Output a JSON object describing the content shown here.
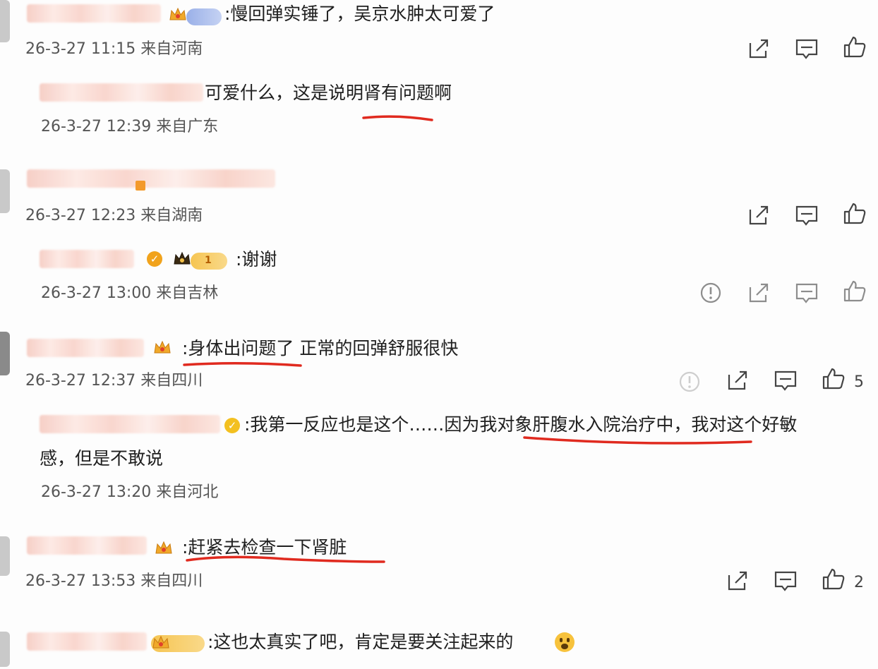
{
  "comments": [
    {
      "text": ":慢回弹实锤了，吴京水肿太可爱了",
      "meta": "26-3-27 11:15 来自河南",
      "reply": {
        "text": "可爱什么，这是说明肾有问题啊",
        "meta": "26-3-27 12:39 来自广东"
      }
    },
    {
      "meta": "26-3-27 12:23 来自湖南",
      "reply": {
        "text": ":谢谢",
        "meta": "26-3-27 13:00 来自吉林",
        "level": "1"
      }
    },
    {
      "text": ":身体出问题了 正常的回弹舒服很快",
      "meta": "26-3-27 12:37 来自四川",
      "likes": "5",
      "reply": {
        "text_line1": ":我第一反应也是这个……因为我对象肝腹水入院治疗中，我对这个好敏",
        "text_line2": "感，但是不敢说",
        "meta": "26-3-27 13:20 来自河北"
      }
    },
    {
      "text": ":赶紧去检查一下肾脏",
      "meta": "26-3-27 13:53 来自四川",
      "likes": "2"
    },
    {
      "text": ":这也太真实了吧，肯定是要关注起来的"
    }
  ],
  "icons": {
    "share": "share-icon",
    "comment": "comment-icon",
    "like": "like-icon",
    "report": "report-icon"
  },
  "colors": {
    "annotation_red": "#e02a1f",
    "badge_gold": "#f6c552"
  }
}
